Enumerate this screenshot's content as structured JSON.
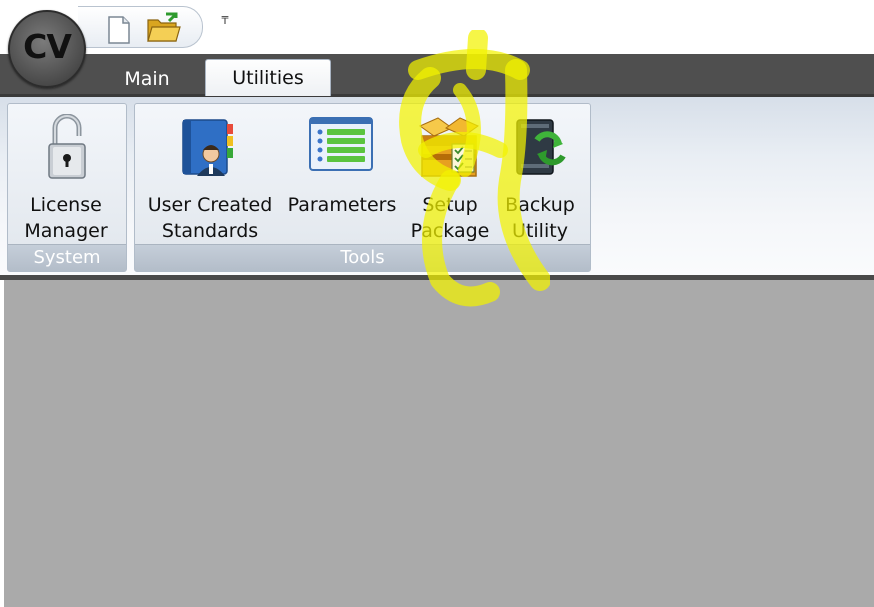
{
  "app_button": {
    "label": "CV"
  },
  "quick_access": {
    "icons": [
      "new-document-icon",
      "open-folder-icon"
    ],
    "customize_glyph": "₸"
  },
  "tabs": [
    {
      "label": "Main",
      "selected": false
    },
    {
      "label": "Utilities",
      "selected": true
    }
  ],
  "groups": {
    "system": {
      "label": "System",
      "buttons": [
        {
          "line1": "License",
          "line2": "Manager",
          "icon": "padlock-icon"
        }
      ]
    },
    "tools": {
      "label": "Tools",
      "buttons": [
        {
          "line1": "User Created",
          "line2": "Standards",
          "icon": "address-book-user-icon"
        },
        {
          "line1": "Parameters",
          "line2": "",
          "icon": "list-icon"
        },
        {
          "line1": "Setup",
          "line2": "Package",
          "icon": "package-box-icon"
        },
        {
          "line1": "Backup",
          "line2": "Utility",
          "icon": "backup-drive-icon"
        }
      ]
    }
  },
  "colors": {
    "title_strip": "#4f4f4f",
    "content_area": "#aaaaaa",
    "highlighter": "#f2f200"
  }
}
